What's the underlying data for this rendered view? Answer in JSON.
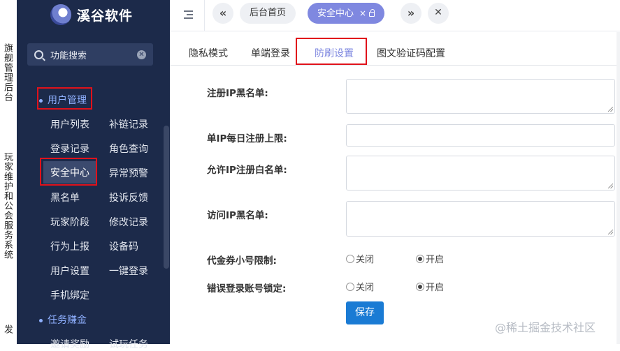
{
  "rail": {
    "text1": "旗舰管理后台",
    "text2": "玩家维护和公会服务系统",
    "text3": "发"
  },
  "sidebar": {
    "logo_text": "溪谷软件",
    "search_placeholder": "功能搜索",
    "groups": [
      {
        "label": "用户管理"
      },
      {
        "label": "任务赚金"
      }
    ],
    "items": [
      {
        "label": "用户列表"
      },
      {
        "label": "补链记录"
      },
      {
        "label": "登录记录"
      },
      {
        "label": "角色查询"
      },
      {
        "label": "安全中心"
      },
      {
        "label": "异常预警"
      },
      {
        "label": "黑名单"
      },
      {
        "label": "投诉反馈"
      },
      {
        "label": "玩家阶段"
      },
      {
        "label": "修改记录"
      },
      {
        "label": "行为上报"
      },
      {
        "label": "设备码"
      },
      {
        "label": "用户设置"
      },
      {
        "label": "一键登录"
      },
      {
        "label": "手机绑定"
      },
      {
        "label": "邀请奖励"
      },
      {
        "label": "试玩任务"
      }
    ]
  },
  "topbar": {
    "prev_icon": "«",
    "next_icon": "»",
    "close_icon": "✕",
    "tab_home": "后台首页",
    "tab_active": "安全中心",
    "tab_close": "×"
  },
  "content": {
    "tabs": [
      {
        "label": "隐私模式"
      },
      {
        "label": "单端登录"
      },
      {
        "label": "防刷设置"
      },
      {
        "label": "图文验证码配置"
      }
    ],
    "fields": {
      "ip_blacklist_label": "注册IP黑名单:",
      "ip_daily_limit_label": "单IP每日注册上限:",
      "ip_whitelist_label": "允许IP注册白名单:",
      "visit_blacklist_label": "访问IP黑名单:",
      "voucher_limit_label": "代金券小号限制:",
      "login_lock_label": "错误登录账号锁定:",
      "off_label": "关闭",
      "on_label": "开启"
    },
    "radios": {
      "voucher_limit": "开启",
      "login_lock": "开启"
    },
    "save_label": "保存",
    "watermark": "@稀土掘金技术社区"
  },
  "colors": {
    "sidebar_bg": "#1c2a4a",
    "accent": "#7f88e0",
    "primary_button": "#1a7bd4",
    "highlight": "#e0121b"
  }
}
